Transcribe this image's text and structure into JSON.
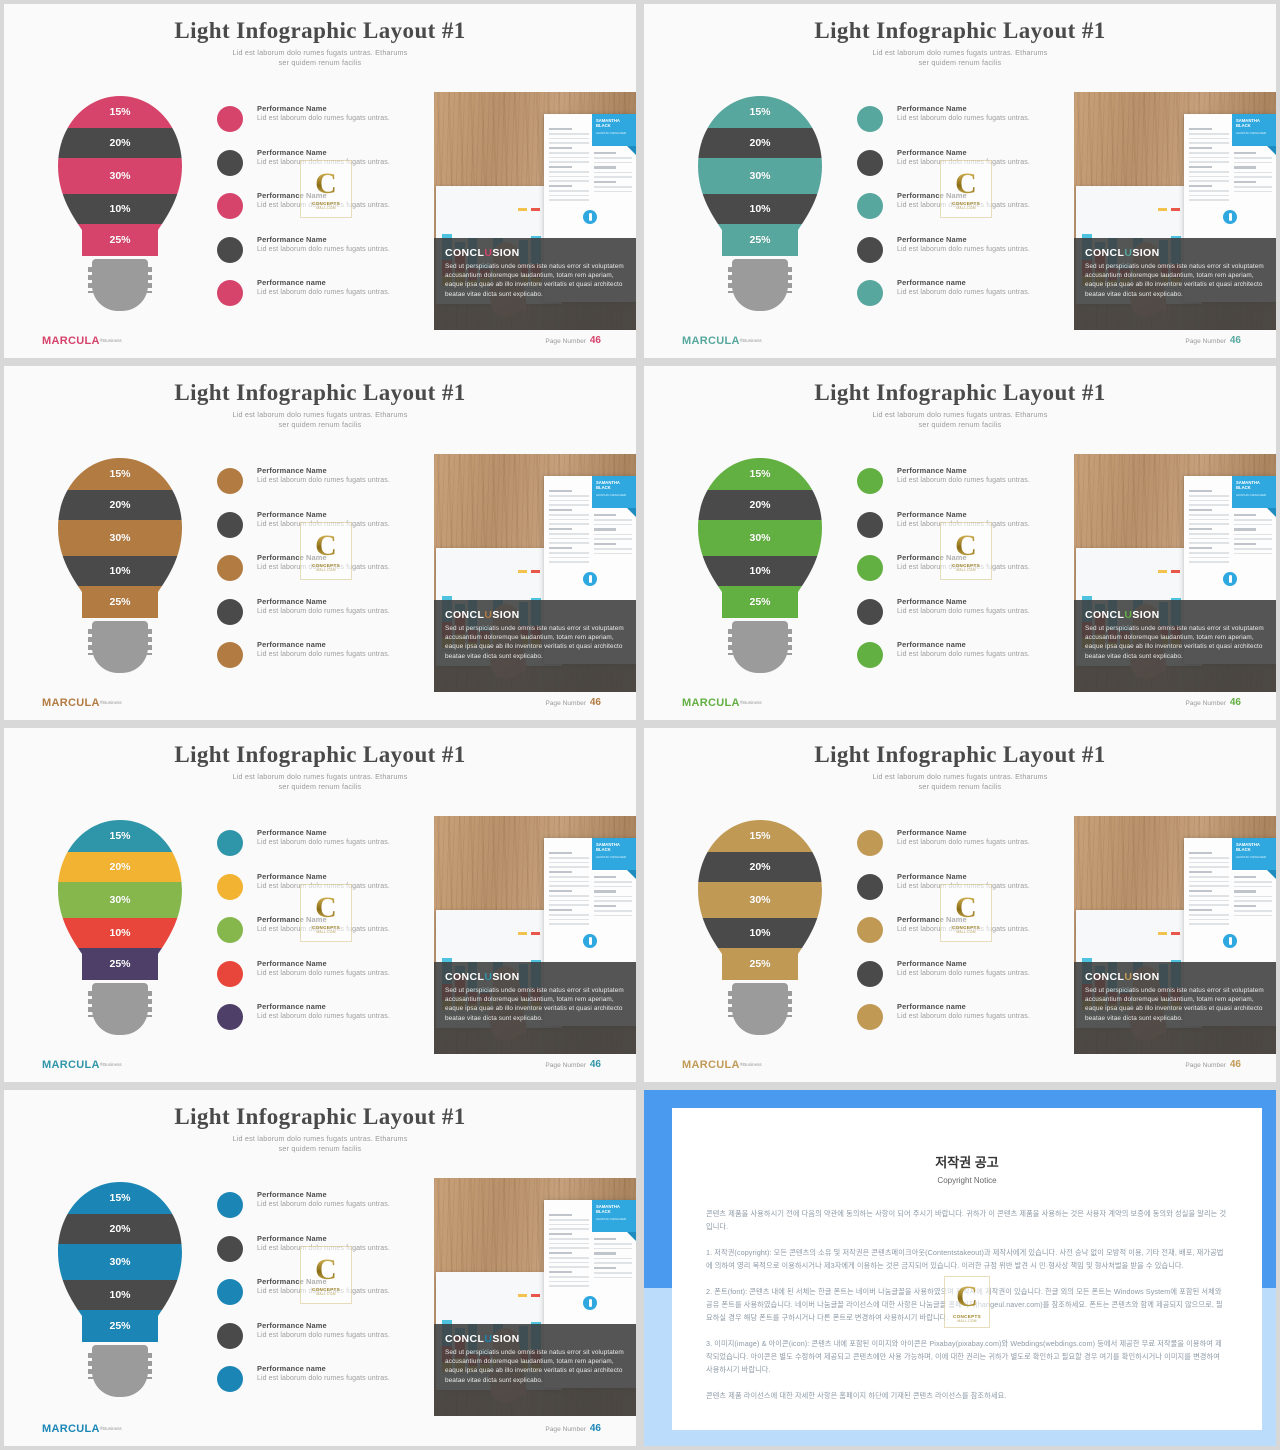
{
  "deck": {
    "title": "Light Infographic Layout #1",
    "subtitle_line1": "Lid est laborum dolo rumes  fugats untras. Etharums",
    "subtitle_line2": "ser quidem renum facilis",
    "brand": "MARCULA",
    "brand_suffix": "®Business",
    "page_label": "Page Number",
    "page_number": "46",
    "conclusion": {
      "title_pre": "CONCL",
      "title_hl": "U",
      "title_post": "SION",
      "body": "Sed ut perspiciatis  unde omnis iste natus error sit voluptatem accusantium doloremque laudantium, totam rem aperiam,  eaque ipsa quae ab illo inventore veritatis et quasi architecto  beatae vitae dicta sunt explicabo."
    },
    "bulb_bands": [
      {
        "label": "15%"
      },
      {
        "label": "20%"
      },
      {
        "label": "30%"
      },
      {
        "label": "10%"
      },
      {
        "label": "25%"
      }
    ],
    "legend_rows": [
      {
        "name": "Performance Name",
        "desc": "Lid est laborum dolo rumes  fugats untras."
      },
      {
        "name": "Performance Name",
        "desc": "Lid est laborum dolo rumes  fugats untras."
      },
      {
        "name": "Performance Name",
        "desc": "Lid est laborum dolo rumes  fugats untras."
      },
      {
        "name": "Performance Name",
        "desc": "Lid est laborum dolo rumes  fugats untras."
      },
      {
        "name": "Performance name",
        "desc": "Lid est laborum dolo rumes  fugats untras."
      }
    ],
    "photo": {
      "resume_name_line1": "SAMANTHA",
      "resume_name_line2": "BLACK",
      "resume_role": "GRAPHIC DESIGNER"
    },
    "watermark": {
      "letter": "C",
      "line1": "CONCEPTS",
      "line2": "MALL.COM"
    },
    "neutral_dark": "#4a4a4a",
    "base_gray": "#9b9b9b"
  },
  "slides": [
    {
      "id": 1,
      "accent": "#d6436b",
      "band_colors": [
        "#d6436b",
        "#4a4a4a",
        "#d6436b",
        "#4a4a4a",
        "#d6436b"
      ],
      "dot_colors": [
        "#d6436b",
        "#4a4a4a",
        "#d6436b",
        "#4a4a4a",
        "#d6436b"
      ]
    },
    {
      "id": 2,
      "accent": "#57a79e",
      "band_colors": [
        "#57a79e",
        "#4a4a4a",
        "#57a79e",
        "#4a4a4a",
        "#57a79e"
      ],
      "dot_colors": [
        "#57a79e",
        "#4a4a4a",
        "#57a79e",
        "#4a4a4a",
        "#57a79e"
      ]
    },
    {
      "id": 3,
      "accent": "#b27b42",
      "band_colors": [
        "#b27b42",
        "#4a4a4a",
        "#b27b42",
        "#4a4a4a",
        "#b27b42"
      ],
      "dot_colors": [
        "#b27b42",
        "#4a4a4a",
        "#b27b42",
        "#4a4a4a",
        "#b27b42"
      ]
    },
    {
      "id": 4,
      "accent": "#62af42",
      "band_colors": [
        "#62af42",
        "#4a4a4a",
        "#62af42",
        "#4a4a4a",
        "#62af42"
      ],
      "dot_colors": [
        "#62af42",
        "#4a4a4a",
        "#62af42",
        "#4a4a4a",
        "#62af42"
      ]
    },
    {
      "id": 5,
      "accent": "#2f95a8",
      "band_colors": [
        "#2f95a8",
        "#f2b332",
        "#85b74c",
        "#e8463a",
        "#4e3f69"
      ],
      "dot_colors": [
        "#2f95a8",
        "#f2b332",
        "#85b74c",
        "#e8463a",
        "#4e3f69"
      ]
    },
    {
      "id": 6,
      "accent": "#c09a55",
      "band_colors": [
        "#c09a55",
        "#4a4a4a",
        "#c09a55",
        "#4a4a4a",
        "#c09a55"
      ],
      "dot_colors": [
        "#c09a55",
        "#4a4a4a",
        "#c09a55",
        "#4a4a4a",
        "#c09a55"
      ]
    },
    {
      "id": 7,
      "accent": "#1b86b5",
      "band_colors": [
        "#1b86b5",
        "#4a4a4a",
        "#1b86b5",
        "#4a4a4a",
        "#1b86b5"
      ],
      "dot_colors": [
        "#1b86b5",
        "#4a4a4a",
        "#1b86b5",
        "#4a4a4a",
        "#1b86b5"
      ]
    }
  ],
  "copyright": {
    "heading_ko": "저작권 공고",
    "heading_en": "Copyright Notice",
    "intro": "콘텐츠 제품을 사용하시기 전에 다음의 약관에 동의하는 사항이 되어 주시기 바랍니다. 귀하가 이 콘텐츠 제품을 사용하는 것은 사용자 계약의 보증에 동의와 성실을 알리는 것입니다.",
    "p1": "1. 저작권(copyright): 모든 콘텐츠의 소유 및 저작권은 콘텐츠메이크아웃(Contentstakeout)과 제작사에게 있습니다. 사전 승낙 없이 모방적 이용, 기타 전재, 배포, 재가공법에 의하여 영리 목적으로 이용하시거나 제3자에게 이용하는 것은 금지되어 있습니다. 이러한 규정 위반 발견 시 민·형사상 책임 및 형사처벌을 받을 수 있습니다.",
    "p2": "2. 폰트(font): 콘텐츠 내에 된 서체는 한글 폰트는 네이버 나눔글꼴을 사용하였으며 제작사에 저작권이 있습니다. 한글 외의 모든 폰트는 Windows System에 포함된 서체와 공유 폰트를 사용하였습니다. 네이버 나눔글꼴 라이선스에 대한 사항은 나눔글꼴 홈페이지(hangeul.naver.com)를 참조하세요. 폰트는 콘텐츠와 함께 제공되지 않으므로, 필요하실 경우 해당 폰트를 구하시거나 다른 폰트로 변경하여 사용하시기 바랍니다.",
    "p3": "3. 이미지(image) & 아이콘(icon): 콘텐츠 내에 포함된 이미지와 아이콘은 Pixabay(pixabay.com)와 Webdings(webdings.com) 등에서 제공한 무료 저작물을 이용하여 제작되었습니다. 아이콘은 별도 수정하여 제공되고 콘텐츠에만 사용 가능하며, 이에 대한 권리는 귀하가 별도로 확인하고 필요할 경우 여기를 확인하시거나 이미지를 변경하여 사용하시기 바랍니다.",
    "footer": "콘텐츠 제품 라이선스에 대한 자세한 사항은 홈페이지 하단에 기재된 콘텐츠 라이선스를 참조하세요."
  }
}
